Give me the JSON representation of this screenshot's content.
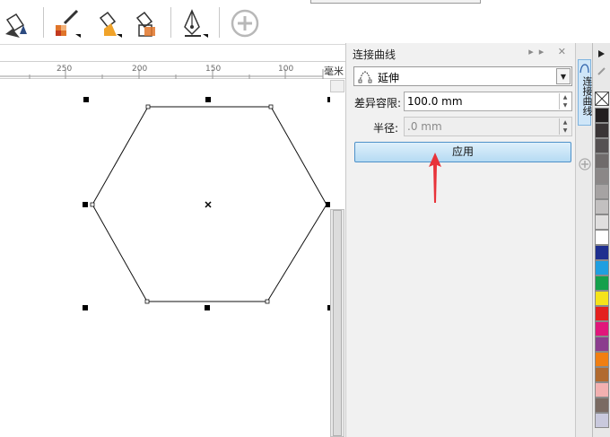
{
  "ruler": {
    "ticks": [
      "250",
      "200",
      "150",
      "100"
    ],
    "unit": "毫米"
  },
  "docker": {
    "title": "连接曲线",
    "controls": "▸▸ ✕",
    "mode_value": "延伸",
    "tolerance_label": "差异容限:",
    "tolerance_value": "100.0 mm",
    "radius_label": "半径:",
    "radius_value": ".0 mm",
    "apply_label": "应用"
  },
  "tabstrip": {
    "tab_label": "连接曲线"
  },
  "palette": {
    "colors": [
      "#231f20",
      "#3a3536",
      "#555152",
      "#6f6b6b",
      "#8b8787",
      "#a6a3a3",
      "#c2c0c0",
      "#e0dfdf",
      "#ffffff",
      "#1e2f8f",
      "#1f9fe0",
      "#14a04b",
      "#f5e31a",
      "#e4201e",
      "#e0177b",
      "#8b3d8e",
      "#f07f12",
      "#b16a2f",
      "#f2b0b0",
      "#7a6a62",
      "#c9c9dd"
    ]
  },
  "colors": {
    "accent_blue": "#4e91c9",
    "arrow_red": "#e8333a"
  }
}
